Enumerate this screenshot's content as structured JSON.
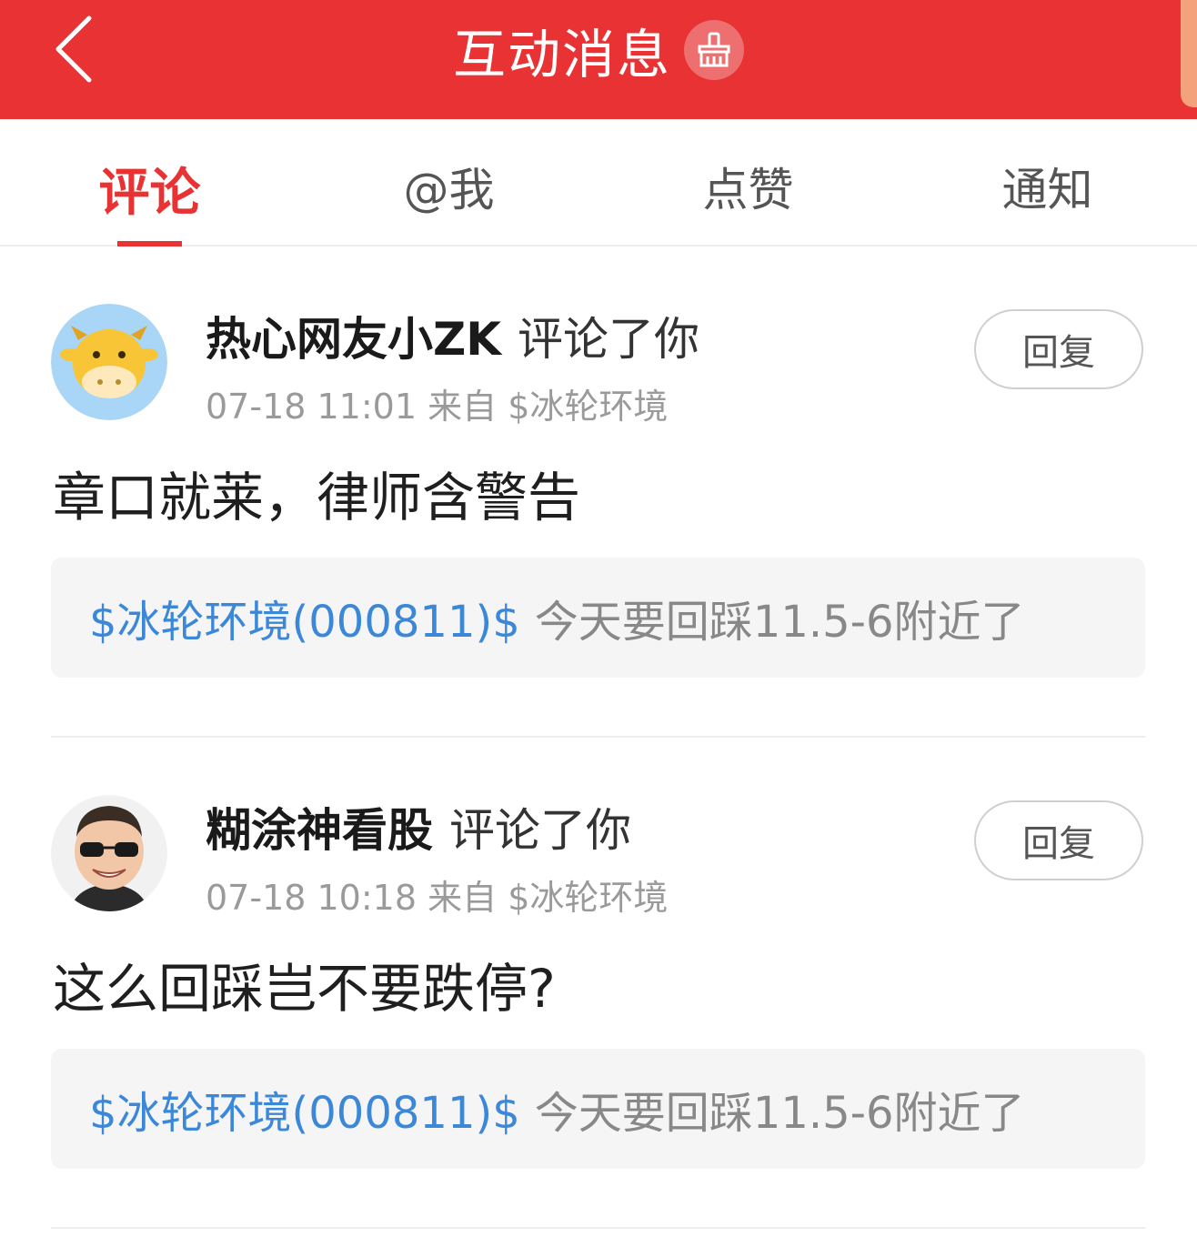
{
  "header": {
    "title": "互动消息",
    "background": "#e83233",
    "back_icon": "chevron-left-icon",
    "clear_icon": "broom-icon"
  },
  "tabs": [
    {
      "label": "评论",
      "active": true
    },
    {
      "label": "@我",
      "active": false
    },
    {
      "label": "点赞",
      "active": false
    },
    {
      "label": "通知",
      "active": false
    }
  ],
  "messages": [
    {
      "user": "热心网友小ZK",
      "action": "评论了你",
      "time": "07-18 11:01",
      "source": "来自 $冰轮环境",
      "reply_label": "回复",
      "content": "章口就莱，律师含警告",
      "quote_stock": "$冰轮环境(000811)$",
      "quote_text": "今天要回踩11.5-6附近了",
      "avatar": "cow-cartoon-avatar"
    },
    {
      "user": "糊涂神看股",
      "action": "评论了你",
      "time": "07-18 10:18",
      "source": "来自 $冰轮环境",
      "reply_label": "回复",
      "content": "这么回踩岂不要跌停?",
      "quote_stock": "$冰轮环境(000811)$",
      "quote_text": "今天要回踩11.5-6附近了",
      "avatar": "sunglasses-man-avatar"
    }
  ],
  "colors": {
    "accent": "#e83233",
    "link": "#3b87d8",
    "quote_bg": "#f5f5f5"
  }
}
